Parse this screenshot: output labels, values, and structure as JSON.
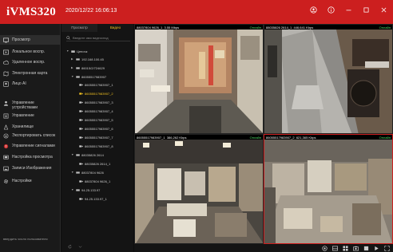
{
  "app": {
    "logo": "iVMS320",
    "datetime": "2020/12/22 16:06:13",
    "accent": "#cc1f1f",
    "title_icons": [
      "user-icon",
      "info-icon",
      "minimize-icon",
      "maximize-icon",
      "close-icon"
    ]
  },
  "sidebar": {
    "items": [
      {
        "label": "Просмотр",
        "icon": "monitor-icon",
        "active": true
      },
      {
        "label": "Локальное воспр.",
        "icon": "play-icon"
      },
      {
        "label": "Удаленное воспр.",
        "icon": "cloud-play-icon"
      },
      {
        "label": "Электронная карта",
        "icon": "map-icon"
      },
      {
        "label": "Лицо AI",
        "icon": "face-icon"
      },
      {
        "label": "Управление устройствами",
        "icon": "person-icon"
      },
      {
        "label": "Управление",
        "icon": "settings-icon"
      },
      {
        "label": "Хранилище",
        "icon": "storage-icon"
      },
      {
        "label": "Экспортировать список",
        "icon": "export-icon"
      },
      {
        "label": "Управление сигналами",
        "icon": "alarm-icon"
      },
      {
        "label": "Настройка просмотра",
        "icon": "view-icon"
      },
      {
        "label": "Записи Изображения",
        "icon": "image-icon"
      },
      {
        "label": "Настройки",
        "icon": "gear-icon"
      }
    ],
    "footer": "ввердить чиcло пользователя"
  },
  "tree": {
    "tabs": [
      {
        "label": "Просмотр",
        "active": false
      },
      {
        "label": "Видео",
        "active": true
      }
    ],
    "search_placeholder": "Введите имя видеоспод",
    "nodes": [
      {
        "label": "Цепочк",
        "depth": 0,
        "type": "group",
        "expanded": true
      },
      {
        "label": "192.168.100.45",
        "depth": 1,
        "type": "device",
        "expanded": false
      },
      {
        "label": "86015/2/724629",
        "depth": 1,
        "type": "device",
        "expanded": false
      },
      {
        "label": "86055517983907",
        "depth": 1,
        "type": "device",
        "expanded": true
      },
      {
        "label": "86055517983907_1",
        "depth": 2,
        "type": "camera"
      },
      {
        "label": "86055517983907_2",
        "depth": 2,
        "type": "camera",
        "highlight": true
      },
      {
        "label": "86055517983907_3",
        "depth": 2,
        "type": "camera"
      },
      {
        "label": "86055517983907_4",
        "depth": 2,
        "type": "camera"
      },
      {
        "label": "86055517983907_5",
        "depth": 2,
        "type": "camera"
      },
      {
        "label": "86055517983907_6",
        "depth": 2,
        "type": "camera"
      },
      {
        "label": "86055517983907_7",
        "depth": 2,
        "type": "camera"
      },
      {
        "label": "86055517983907_8",
        "depth": 2,
        "type": "camera"
      },
      {
        "label": "88035826 2614",
        "depth": 1,
        "type": "device",
        "expanded": true
      },
      {
        "label": "88035826 2614_1",
        "depth": 2,
        "type": "camera"
      },
      {
        "label": "88037804 9626",
        "depth": 1,
        "type": "device",
        "expanded": true
      },
      {
        "label": "88037804 9626_1",
        "depth": 2,
        "type": "camera"
      },
      {
        "label": "94.25.133.97",
        "depth": 1,
        "type": "device",
        "expanded": true
      },
      {
        "label": "94.25.133.97_1",
        "depth": 2,
        "type": "camera"
      }
    ],
    "bottom_icons": [
      "refresh-icon",
      "collapse-icon"
    ]
  },
  "tiles": [
    {
      "name": "88037804 9626_1",
      "rate": "3.55 Mbps",
      "status": "Онлайн",
      "selected": false
    },
    {
      "name": "88035826 2614_1",
      "rate": "446,641 Kbps",
      "status": "Онлайн",
      "selected": false
    },
    {
      "name": "86055517983907_1",
      "rate": "386,262 Kbps",
      "status": "Онлайн",
      "selected": false
    },
    {
      "name": "86055517983907_2",
      "rate": "621,365 Kbps",
      "status": "Онлайн",
      "selected": true
    }
  ],
  "toolbar": {
    "icons": [
      "record-icon",
      "layout-icon",
      "grid-icon",
      "snapshot-icon",
      "stop-all-icon",
      "sequence-icon",
      "fullscreen-icon"
    ]
  }
}
